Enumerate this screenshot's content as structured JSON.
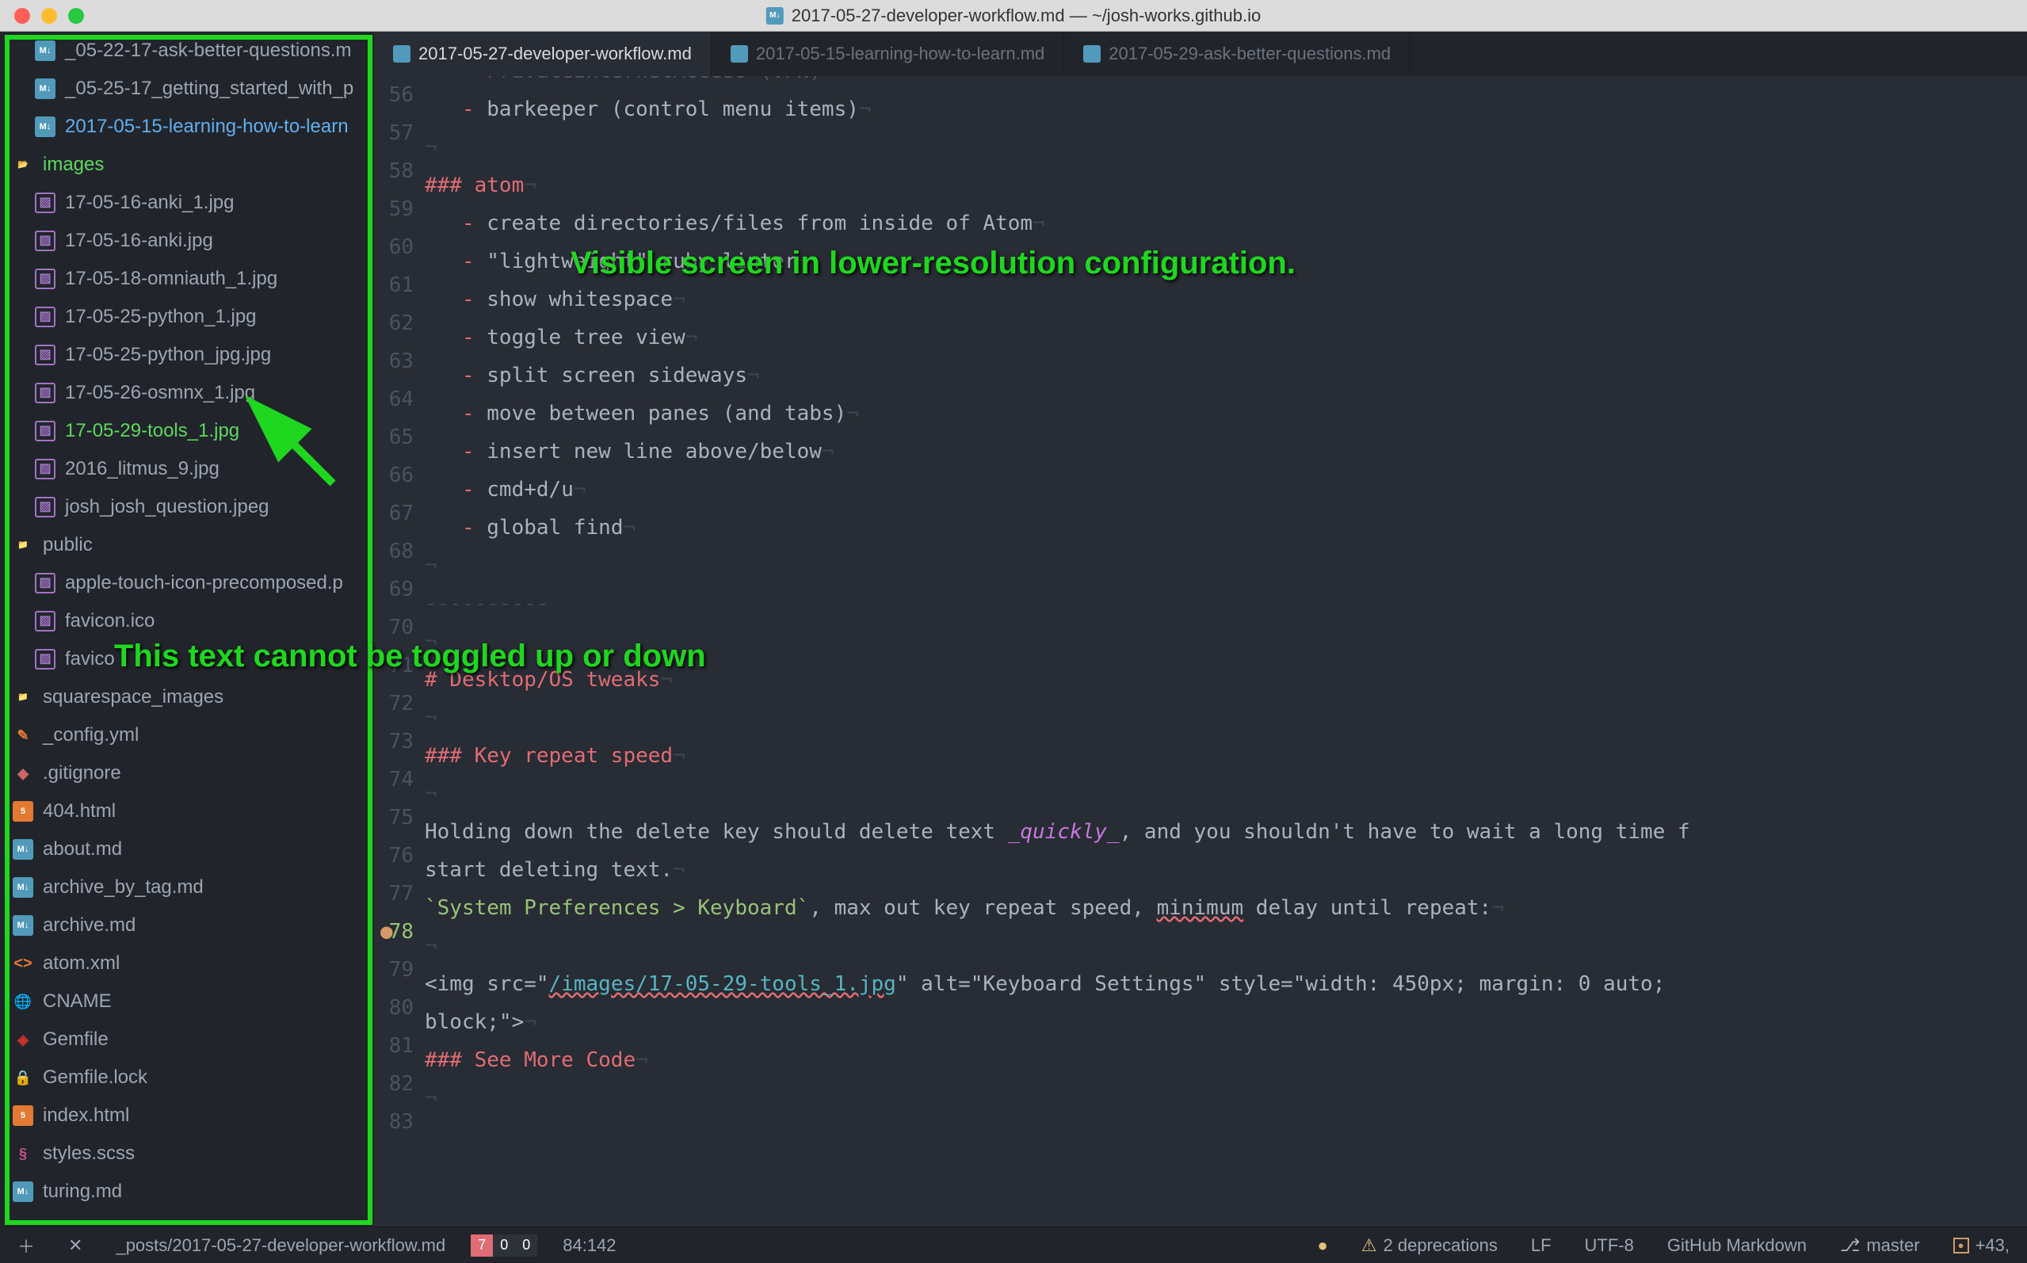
{
  "window": {
    "title": "2017-05-27-developer-workflow.md — ~/josh-works.github.io"
  },
  "tabs": [
    {
      "label": "2017-05-27-developer-workflow.md",
      "active": true
    },
    {
      "label": "2017-05-15-learning-how-to-learn.md",
      "active": false
    },
    {
      "label": "2017-05-29-ask-better-questions.md",
      "active": false
    }
  ],
  "tree": [
    {
      "label": "_05-22-17-ask-better-questions.m",
      "icon": "md",
      "indent": 1
    },
    {
      "label": "_05-25-17_getting_started_with_p",
      "icon": "md",
      "indent": 1
    },
    {
      "label": "2017-05-15-learning-how-to-learn",
      "icon": "md",
      "indent": 1,
      "active": true
    },
    {
      "label": "images",
      "icon": "folder-green",
      "indent": 0,
      "green": true
    },
    {
      "label": "17-05-16-anki_1.jpg",
      "icon": "img",
      "indent": 1
    },
    {
      "label": "17-05-16-anki.jpg",
      "icon": "img",
      "indent": 1
    },
    {
      "label": "17-05-18-omniauth_1.jpg",
      "icon": "img",
      "indent": 1
    },
    {
      "label": "17-05-25-python_1.jpg",
      "icon": "img",
      "indent": 1
    },
    {
      "label": "17-05-25-python_jpg.jpg",
      "icon": "img",
      "indent": 1
    },
    {
      "label": "17-05-26-osmnx_1.jpg",
      "icon": "img",
      "indent": 1
    },
    {
      "label": "17-05-29-tools_1.jpg",
      "icon": "img",
      "indent": 1,
      "green": true
    },
    {
      "label": "2016_litmus_9.jpg",
      "icon": "img",
      "indent": 1
    },
    {
      "label": "josh_josh_question.jpeg",
      "icon": "img",
      "indent": 1
    },
    {
      "label": "public",
      "icon": "folder",
      "indent": 0
    },
    {
      "label": "apple-touch-icon-precomposed.p",
      "icon": "img",
      "indent": 1
    },
    {
      "label": "favicon.ico",
      "icon": "img",
      "indent": 1
    },
    {
      "label": "favico",
      "icon": "img",
      "indent": 1
    },
    {
      "label": "squarespace_images",
      "icon": "folder",
      "indent": 0
    },
    {
      "label": "_config.yml",
      "icon": "yml",
      "indent": 0
    },
    {
      "label": ".gitignore",
      "icon": "git",
      "indent": 0
    },
    {
      "label": "404.html",
      "icon": "html",
      "indent": 0
    },
    {
      "label": "about.md",
      "icon": "md",
      "indent": 0
    },
    {
      "label": "archive_by_tag.md",
      "icon": "md",
      "indent": 0
    },
    {
      "label": "archive.md",
      "icon": "md",
      "indent": 0
    },
    {
      "label": "atom.xml",
      "icon": "xml",
      "indent": 0
    },
    {
      "label": "CNAME",
      "icon": "cname",
      "indent": 0
    },
    {
      "label": "Gemfile",
      "icon": "gem",
      "indent": 0
    },
    {
      "label": "Gemfile.lock",
      "icon": "lock",
      "indent": 0
    },
    {
      "label": "index.html",
      "icon": "html",
      "indent": 0
    },
    {
      "label": "styles.scss",
      "icon": "scss",
      "indent": 0
    },
    {
      "label": "turing.md",
      "icon": "md",
      "indent": 0
    }
  ],
  "gutter_start": 56,
  "gutter_end": 83,
  "diff_added": [
    78
  ],
  "diff_modified": [
    78
  ],
  "code": {
    "56": {
      "bullet": "-",
      "text": "PrivateInternetAccess (VPN)",
      "cutoff": true
    },
    "57": {
      "bullet": "-",
      "text": "barkeeper (control menu items)"
    },
    "58": {
      "invis": true
    },
    "59": {
      "h": "### atom"
    },
    "60": {
      "bullet": "-",
      "text": "create directories/files from inside of Atom"
    },
    "61": {
      "bullet": "-",
      "text": "\"lightweight\" ruby linter"
    },
    "62": {
      "bullet": "-",
      "text": "show whitespace"
    },
    "63": {
      "bullet": "-",
      "text": "toggle tree view"
    },
    "64": {
      "bullet": "-",
      "text": "split screen sideways"
    },
    "65": {
      "bullet": "-",
      "text": "move between panes (and tabs)"
    },
    "66": {
      "bullet": "-",
      "text": "insert new line above/below"
    },
    "67": {
      "bullet": "-",
      "text": "cmd+d/u"
    },
    "68": {
      "bullet": "-",
      "text": "global find"
    },
    "69": {
      "invis": true
    },
    "70": {
      "hr": "----------"
    },
    "71": {
      "invis": true
    },
    "72": {
      "h": "# Desktop/OS tweaks"
    },
    "73": {
      "invis": true
    },
    "74": {
      "h": "### Key repeat speed"
    },
    "75": {
      "invis": true
    },
    "76": {
      "para_start": "Holding down the delete key should delete text ",
      "italic": "_quickly_",
      "para_mid": ", and you shouldn't have to wait a long time f"
    },
    "77": {
      "para_cont": "start deleting text."
    },
    "78": {
      "code_inline": "`System Preferences > Keyboard`",
      "after": ", max out key repeat speed, ",
      "wavy": "minimum",
      "after2": " delay until repeat:",
      "cutoff_right": " c"
    },
    "79": {
      "invis": true
    },
    "80": {
      "raw": "<img src=\"",
      "url": "/images/17-05-29-tools_1.jpg",
      "raw2": "\" alt=\"Keyboard Settings\" style=\"width: 450px; margin: 0 auto; ",
      "cutoff_right": "c"
    },
    "81": {
      "raw_cont": "block;\">"
    },
    "82": {
      "h": "### See More Code"
    },
    "83": {
      "invis": true
    }
  },
  "status": {
    "path": "_posts/2017-05-27-developer-workflow.md",
    "counts": [
      "7",
      "0",
      "0"
    ],
    "cursor": "84:142",
    "deprecations": "2 deprecations",
    "encoding": "UTF-8",
    "line_ending": "LF",
    "grammar": "GitHub Markdown",
    "branch": "master",
    "diff": "+43,"
  },
  "annotations": {
    "top": "Visible screen in lower-resolution configuration.",
    "bottom": "This text cannot be toggled up or down"
  }
}
